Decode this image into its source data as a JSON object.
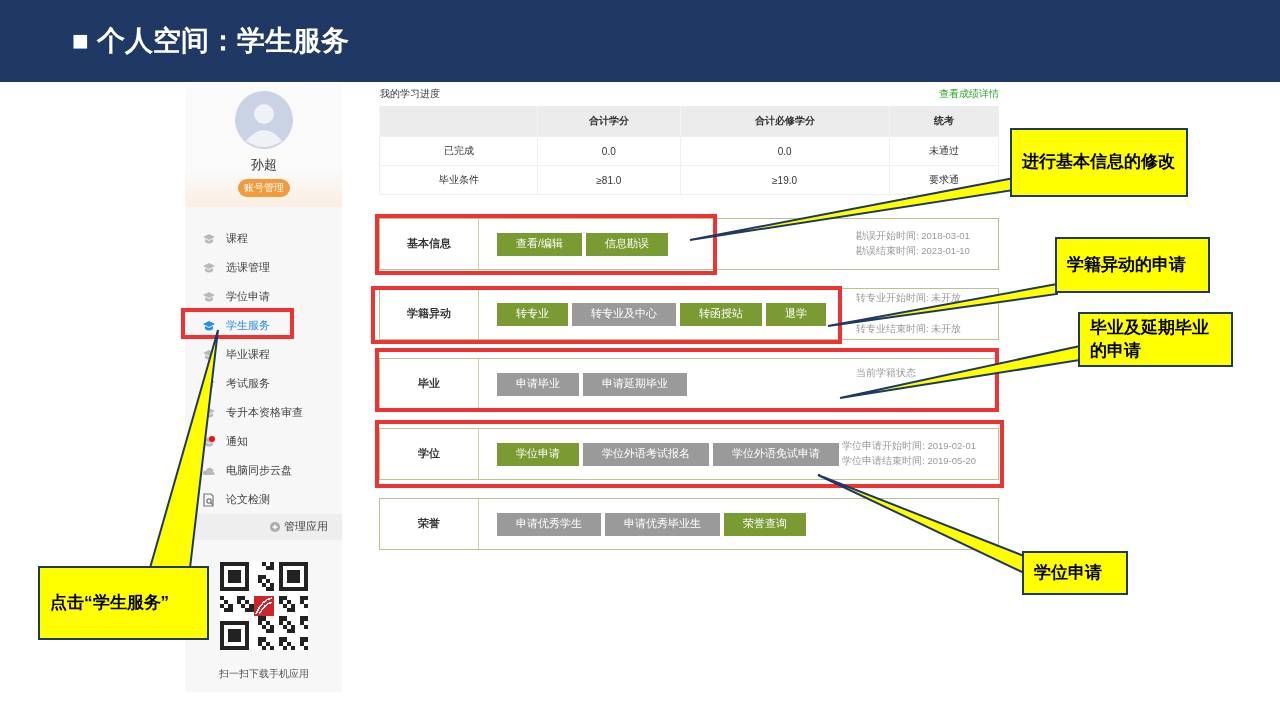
{
  "slide_title": "■ 个人空间：学生服务",
  "profile": {
    "name": "孙超",
    "account_button": "账号管理"
  },
  "sidebar": {
    "items": [
      {
        "label": "课程",
        "kind": "hat",
        "selected": false,
        "unread": false
      },
      {
        "label": "选课管理",
        "kind": "hat",
        "selected": false,
        "unread": false
      },
      {
        "label": "学位申请",
        "kind": "hat",
        "selected": false,
        "unread": false
      },
      {
        "label": "学生服务",
        "kind": "hat",
        "selected": true,
        "unread": false
      },
      {
        "label": "毕业课程",
        "kind": "hat",
        "selected": false,
        "unread": false
      },
      {
        "label": "考试服务",
        "kind": "hat",
        "selected": false,
        "unread": false
      },
      {
        "label": "专升本资格审查",
        "kind": "hat",
        "selected": false,
        "unread": false
      },
      {
        "label": "通知",
        "kind": "hat",
        "selected": false,
        "unread": true
      },
      {
        "label": "电脑同步云盘",
        "kind": "cloud",
        "selected": false,
        "unread": false
      },
      {
        "label": "论文检测",
        "kind": "doc",
        "selected": false,
        "unread": false
      }
    ],
    "manage_apps": "管理应用",
    "qr_caption": "扫一扫下载手机应用"
  },
  "progress": {
    "title": "我的学习进度",
    "link": "查看成绩详情",
    "columns": [
      "合计学分",
      "合计必修学分",
      "统考"
    ],
    "rows": [
      {
        "label": "已完成",
        "cells": [
          "0.0",
          "0.0",
          "未通过"
        ]
      },
      {
        "label": "毕业条件",
        "cells": [
          "≥81.0",
          "≥19.0",
          "要求通"
        ]
      }
    ]
  },
  "sections": [
    {
      "label": "基本信息",
      "buttons": [
        {
          "label": "查看/编辑",
          "enabled": true
        },
        {
          "label": "信息勘误",
          "enabled": true
        }
      ],
      "info": [
        "勘误开始时间: 2018-03-01",
        "勘误结束时间: 2023-01-10"
      ]
    },
    {
      "label": "学籍异动",
      "buttons": [
        {
          "label": "转专业",
          "enabled": true
        },
        {
          "label": "转专业及中心",
          "enabled": false
        },
        {
          "label": "转函授站",
          "enabled": true
        },
        {
          "label": "退学",
          "enabled": true
        }
      ],
      "info": [
        "转专业开始时间: 未开放",
        "转专业结束时间: 未开放"
      ]
    },
    {
      "label": "毕业",
      "buttons": [
        {
          "label": "申请毕业",
          "enabled": false
        },
        {
          "label": "申请延期毕业",
          "enabled": false
        }
      ],
      "info": [
        "当前学籍状态"
      ]
    },
    {
      "label": "学位",
      "buttons": [
        {
          "label": "学位申请",
          "enabled": true
        },
        {
          "label": "学位外语考试报名",
          "enabled": false
        },
        {
          "label": "学位外语免试申请",
          "enabled": false
        }
      ],
      "info": [
        "学位申请开始时间: 2019-02-01",
        "学位申请结束时间: 2019-05-20"
      ]
    },
    {
      "label": "荣誉",
      "buttons": [
        {
          "label": "申请优秀学生",
          "enabled": false
        },
        {
          "label": "申请优秀毕业生",
          "enabled": false
        },
        {
          "label": "荣誉查询",
          "enabled": true
        }
      ]
    }
  ],
  "callouts": [
    {
      "text": "进行基本信息的修改"
    },
    {
      "text": "学籍异动的申请"
    },
    {
      "text": "毕业及延期毕业的申请"
    },
    {
      "text": "学位申请"
    },
    {
      "text": "点击“学生服务”"
    }
  ]
}
